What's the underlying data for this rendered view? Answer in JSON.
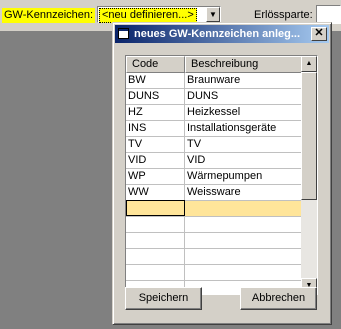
{
  "form": {
    "gw_label": "GW-Kennzeichen:",
    "gw_value": "<neu definieren...>",
    "erlos_label": "Erlössparte:"
  },
  "dialog": {
    "title": "neues GW-Kennzeichen anleg...",
    "columns": {
      "code": "Code",
      "description": "Beschreibung"
    },
    "rows": [
      {
        "code": "BW",
        "description": "Braunware"
      },
      {
        "code": "DUNS",
        "description": "DUNS"
      },
      {
        "code": "HZ",
        "description": "Heizkessel"
      },
      {
        "code": "INS",
        "description": "Installationsgeräte"
      },
      {
        "code": "TV",
        "description": "TV"
      },
      {
        "code": "VID",
        "description": "VID"
      },
      {
        "code": "WP",
        "description": "Wärmepumpen"
      },
      {
        "code": "WW",
        "description": "Weissware"
      }
    ],
    "save_label": "Speichern",
    "cancel_label": "Abbrechen"
  },
  "icons": [
    "app-window-icon",
    "close-icon",
    "chevron-down-icon",
    "scroll-up-icon",
    "scroll-down-icon"
  ],
  "colors": {
    "highlight": "#ffff00",
    "new_row": "#ffe59a",
    "title_bar": "#0a246a"
  }
}
